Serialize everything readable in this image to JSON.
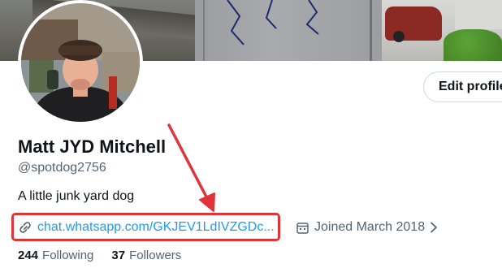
{
  "profile": {
    "name": "Matt JYD Mitchell",
    "handle": "@spotdog2756",
    "bio": "A little junk yard dog",
    "link": "chat.whatsapp.com/GKJEV1LdIVZGDc...",
    "joined": "Joined March 2018"
  },
  "actions": {
    "edit_profile": "Edit profile"
  },
  "stats": {
    "following_count": "244",
    "following_label": "Following",
    "followers_count": "37",
    "followers_label": "Followers"
  },
  "colors": {
    "link": "#1d9bf0",
    "secondary_text": "#536471",
    "annotation": "#e0333a"
  },
  "icons": [
    "link-icon",
    "calendar-icon",
    "chevron-right-icon"
  ]
}
